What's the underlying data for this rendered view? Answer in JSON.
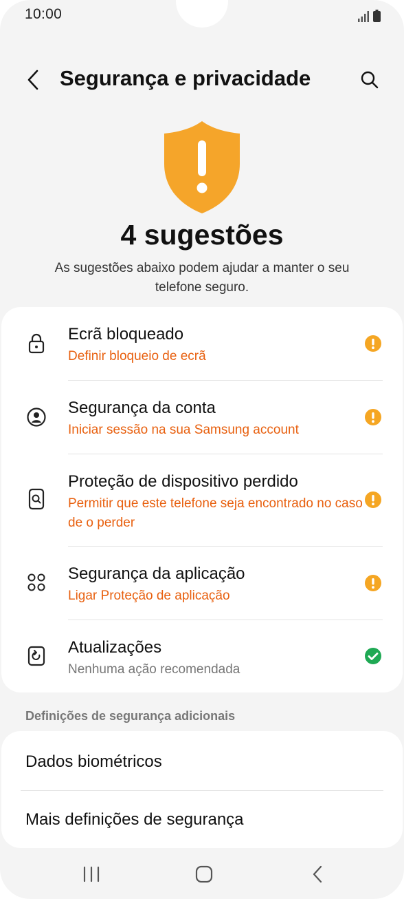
{
  "status_bar": {
    "time": "10:00"
  },
  "header": {
    "title": "Segurança e privacidade"
  },
  "hero": {
    "title": "4 sugestões",
    "description": "As sugestões abaixo podem ajudar a manter o seu telefone seguro."
  },
  "suggestions": [
    {
      "title": "Ecrã bloqueado",
      "subtitle": "Definir bloqueio de ecrã",
      "icon": "lock-icon",
      "status": "warning"
    },
    {
      "title": "Segurança da conta",
      "subtitle": "Iniciar sessão na sua Samsung account",
      "icon": "account-icon",
      "status": "warning"
    },
    {
      "title": "Proteção de dispositivo perdido",
      "subtitle": "Permitir que este telefone seja encontrado no caso de o perder",
      "icon": "find-device-icon",
      "status": "warning"
    },
    {
      "title": "Segurança da aplicação",
      "subtitle": "Ligar Proteção de aplicação",
      "icon": "apps-icon",
      "status": "warning"
    },
    {
      "title": "Atualizações",
      "subtitle": "Nenhuma ação recomendada",
      "icon": "update-icon",
      "status": "ok"
    }
  ],
  "additional": {
    "section_label": "Definições de segurança adicionais",
    "items": [
      {
        "label": "Dados biométricos"
      },
      {
        "label": "Mais definições de segurança"
      }
    ]
  },
  "colors": {
    "warning": "#f5a623",
    "warning_text": "#e8600f",
    "ok": "#1fa954",
    "shield": "#f5a52a"
  }
}
